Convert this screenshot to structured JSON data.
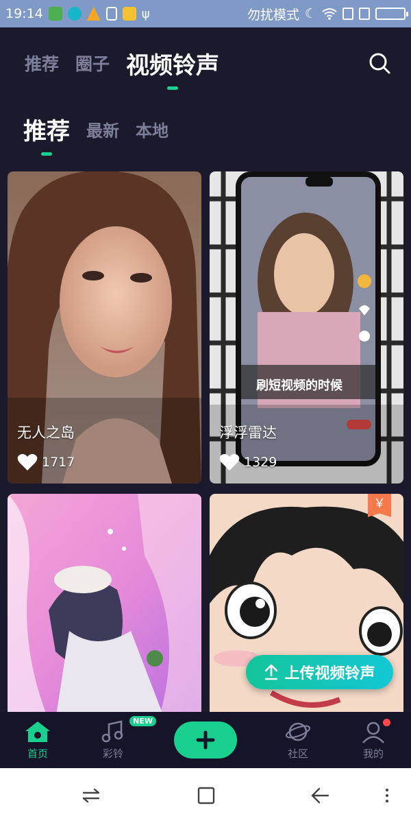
{
  "status_bar": {
    "time": "19:14",
    "mode": "勿扰模式",
    "colors": {
      "bg": "#7f9ac7"
    }
  },
  "top_tabs": {
    "items": [
      {
        "label": "推荐"
      },
      {
        "label": "圈子"
      },
      {
        "label": "视频铃声"
      }
    ],
    "active_index": 2,
    "search_icon": "search-icon"
  },
  "sub_tabs": {
    "items": [
      {
        "label": "推荐"
      },
      {
        "label": "最新"
      },
      {
        "label": "本地"
      }
    ],
    "active_index": 0
  },
  "cards": [
    {
      "title": "无人之岛",
      "likes": "1717"
    },
    {
      "title": "浮浮雷达",
      "likes": "1329",
      "overlay_text": "刷短视频的时候"
    },
    {
      "title": "",
      "likes": ""
    },
    {
      "title": "",
      "likes": "",
      "paid_tag": "￥"
    }
  ],
  "upload_button": {
    "label": "上传视频铃声",
    "icon": "upload-icon"
  },
  "bottom_nav": {
    "items": [
      {
        "label": "首页",
        "icon": "home-icon",
        "active": true
      },
      {
        "label": "彩铃",
        "icon": "music-icon",
        "badge": "NEW"
      },
      {
        "label": "社区",
        "icon": "planet-icon"
      },
      {
        "label": "我的",
        "icon": "profile-icon",
        "dot": true
      }
    ],
    "add_icon": "plus-icon"
  },
  "colors": {
    "background": "#1b1a2c",
    "accent": "#19d08f",
    "inactive_text": "#7b7f99"
  }
}
